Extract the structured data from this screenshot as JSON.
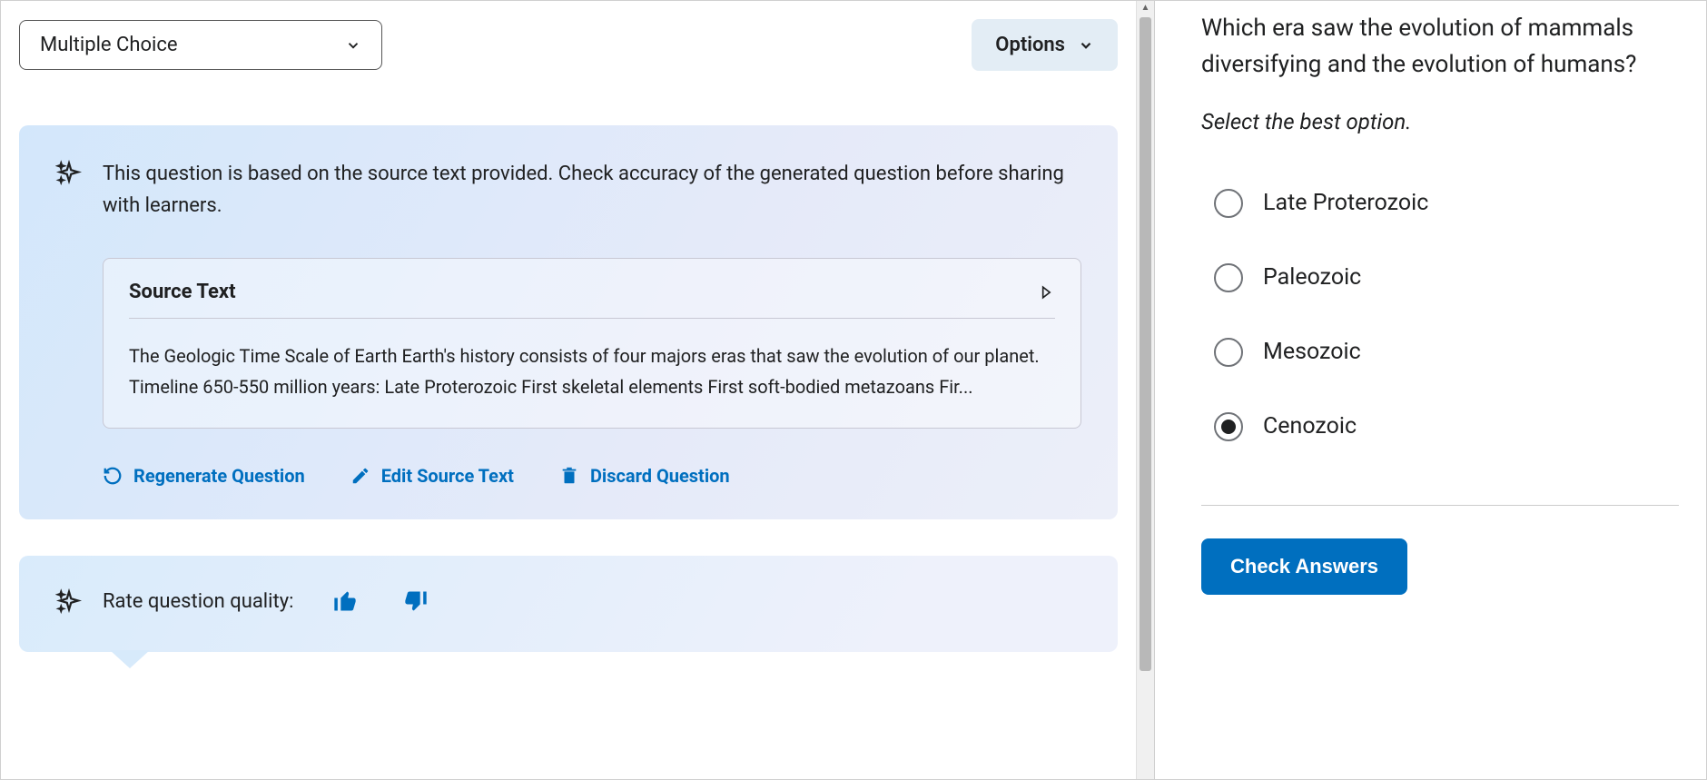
{
  "toolbar": {
    "type_label": "Multiple Choice",
    "options_label": "Options"
  },
  "source_card": {
    "info_text": "This question is based on the source text provided. Check accuracy of the generated question before sharing with learners.",
    "source_title": "Source Text",
    "source_body": "The Geologic Time Scale of Earth Earth's history consists of four majors eras that saw the evolution of our planet. Timeline 650-550 million years: Late Proterozoic First skeletal elements First soft-bodied metazoans Fir...",
    "regenerate_label": "Regenerate Question",
    "edit_label": "Edit Source Text",
    "discard_label": "Discard Question"
  },
  "rate": {
    "label": "Rate question quality:"
  },
  "preview": {
    "question": "Which era saw the evolution of mammals diversifying and the evolution of humans?",
    "instruction": "Select the best option.",
    "options": [
      {
        "label": "Late Proterozoic",
        "selected": false
      },
      {
        "label": "Paleozoic",
        "selected": false
      },
      {
        "label": "Mesozoic",
        "selected": false
      },
      {
        "label": "Cenozoic",
        "selected": true
      }
    ],
    "check_label": "Check Answers"
  }
}
